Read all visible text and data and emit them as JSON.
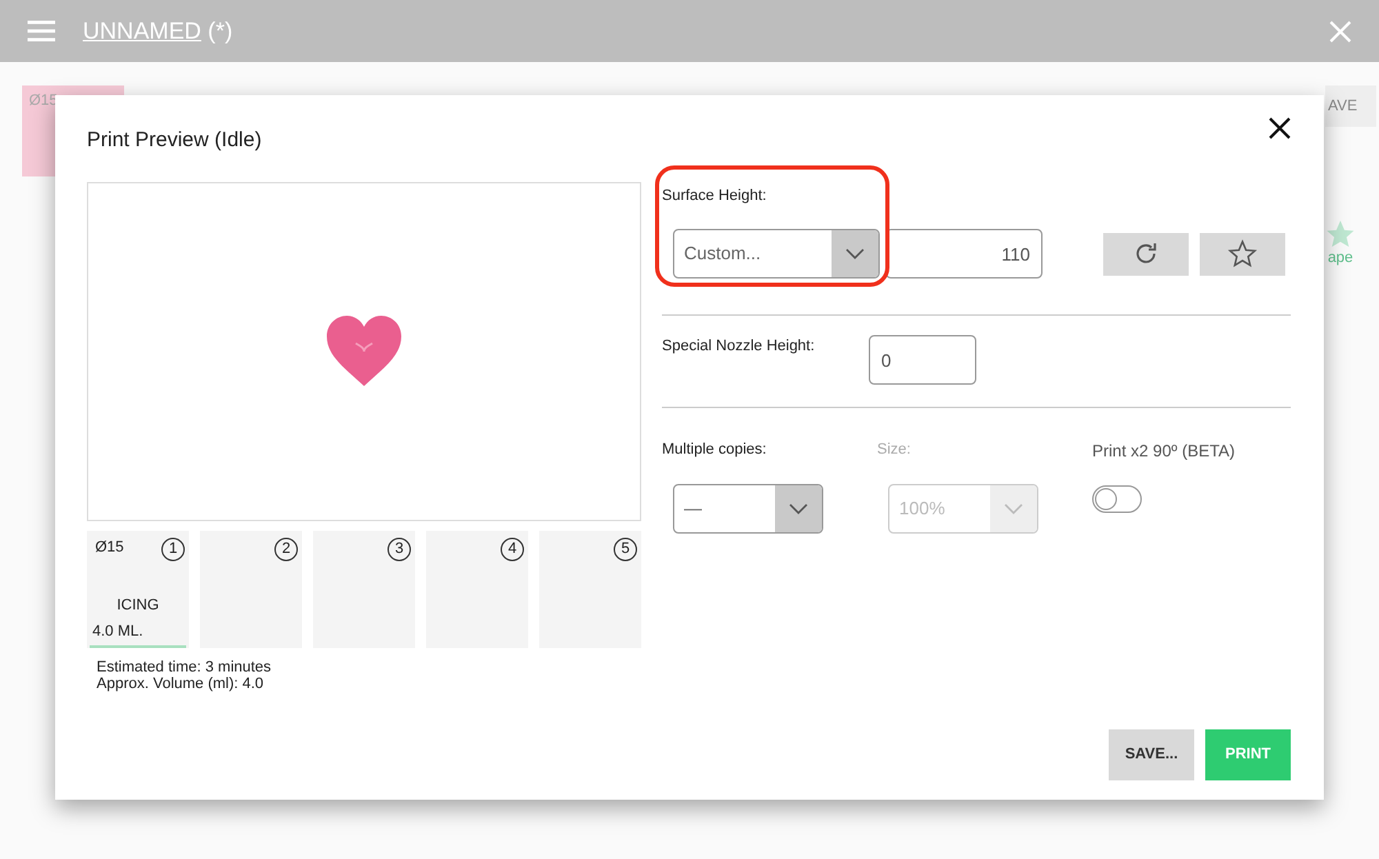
{
  "app_bar": {
    "title": "UNNAMED",
    "suffix": "(*)"
  },
  "background": {
    "tile_label": "Ø15",
    "button_label": "AVE",
    "shape_label": "ape"
  },
  "dialog": {
    "title": "Print Preview (Idle)",
    "slots": [
      {
        "number": "1",
        "diameter": "Ø15",
        "material": "ICING",
        "volume": "4.0 ML."
      },
      {
        "number": "2"
      },
      {
        "number": "3"
      },
      {
        "number": "4"
      },
      {
        "number": "5"
      }
    ],
    "estimated_time": "Estimated time: 3 minutes",
    "approx_volume": "Approx. Volume (ml): 4.0",
    "surface_height": {
      "label": "Surface Height:",
      "selection": "Custom...",
      "value": "110",
      "highlighted": true
    },
    "nozzle": {
      "label": "Special Nozzle Height:",
      "value": "0"
    },
    "copies": {
      "label": "Multiple copies:",
      "selection": "—",
      "disabled": false
    },
    "size": {
      "label": "Size:",
      "selection": "100%",
      "disabled": true
    },
    "rotate": {
      "label": "Print x2 90º (BETA)",
      "on": false
    },
    "buttons": [
      {
        "label": "SAVE...",
        "kind": "secondary"
      },
      {
        "label": "PRINT",
        "kind": "primary"
      }
    ]
  }
}
